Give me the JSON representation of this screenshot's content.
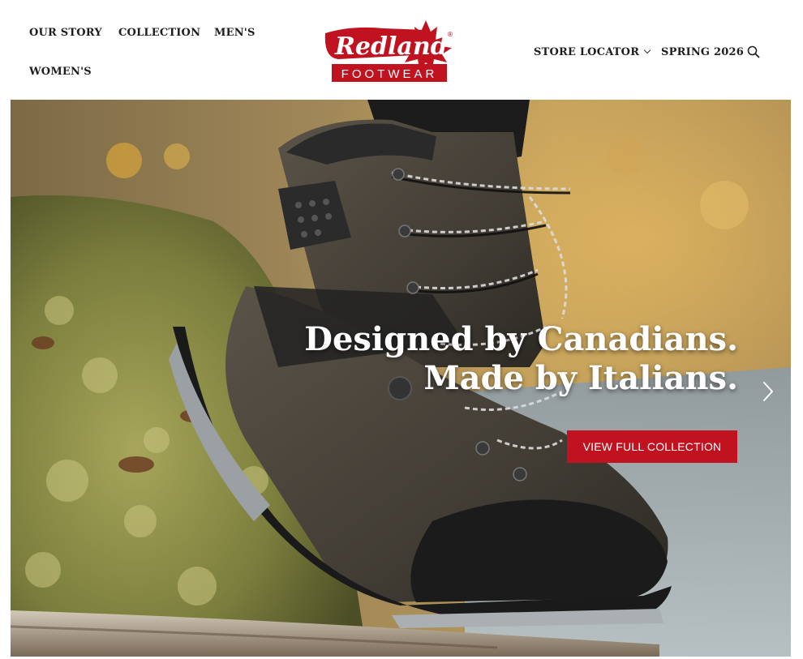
{
  "header": {
    "nav_left": [
      "OUR STORY",
      "COLLECTION",
      "MEN'S",
      "WOMEN'S"
    ],
    "nav_right": [
      "STORE LOCATOR",
      "SPRING 2026"
    ],
    "logo": {
      "word": "Redland",
      "sub": "FOOTWEAR",
      "mark": "®"
    }
  },
  "hero": {
    "headline_line1": "Designed by Canadians.",
    "headline_line2": "Made by Italians.",
    "cta_label": "VIEW FULL COLLECTION"
  },
  "colors": {
    "brand_red": "#c1121f",
    "nav_text": "#1d1d1d",
    "header_bg": "#ffffff"
  },
  "icons": {
    "search": "search-icon",
    "store_dropdown": "chevron-down-icon",
    "carousel_next": "chevron-right-icon",
    "logo_leaf": "maple-leaf-icon"
  }
}
